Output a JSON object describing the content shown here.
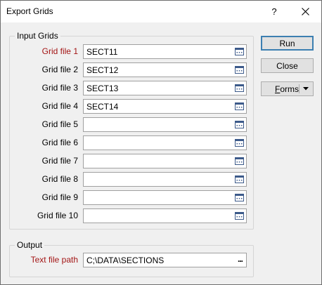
{
  "window": {
    "title": "Export Grids",
    "help_label": "?"
  },
  "input_group": {
    "legend": "Input Grids",
    "rows": [
      {
        "label": "Grid file 1",
        "value": "SECT11",
        "required": true
      },
      {
        "label": "Grid file 2",
        "value": "SECT12",
        "required": false
      },
      {
        "label": "Grid file 3",
        "value": "SECT13",
        "required": false
      },
      {
        "label": "Grid file 4",
        "value": "SECT14",
        "required": false
      },
      {
        "label": "Grid file 5",
        "value": "",
        "required": false
      },
      {
        "label": "Grid file 6",
        "value": "",
        "required": false
      },
      {
        "label": "Grid file 7",
        "value": "",
        "required": false
      },
      {
        "label": "Grid file 8",
        "value": "",
        "required": false
      },
      {
        "label": "Grid file 9",
        "value": "",
        "required": false
      },
      {
        "label": "Grid file 10",
        "value": "",
        "required": false
      }
    ]
  },
  "output_group": {
    "legend": "Output",
    "text_file_label": "Text file path",
    "text_file_value": "C;\\DATA\\SECTIONS",
    "browse_label": "..."
  },
  "buttons": {
    "run": "Run",
    "close": "Close",
    "forms_prefix": "F",
    "forms_rest": "orms"
  },
  "colors": {
    "required_label": "#a31515",
    "default_button_border": "#3c7fb1"
  }
}
